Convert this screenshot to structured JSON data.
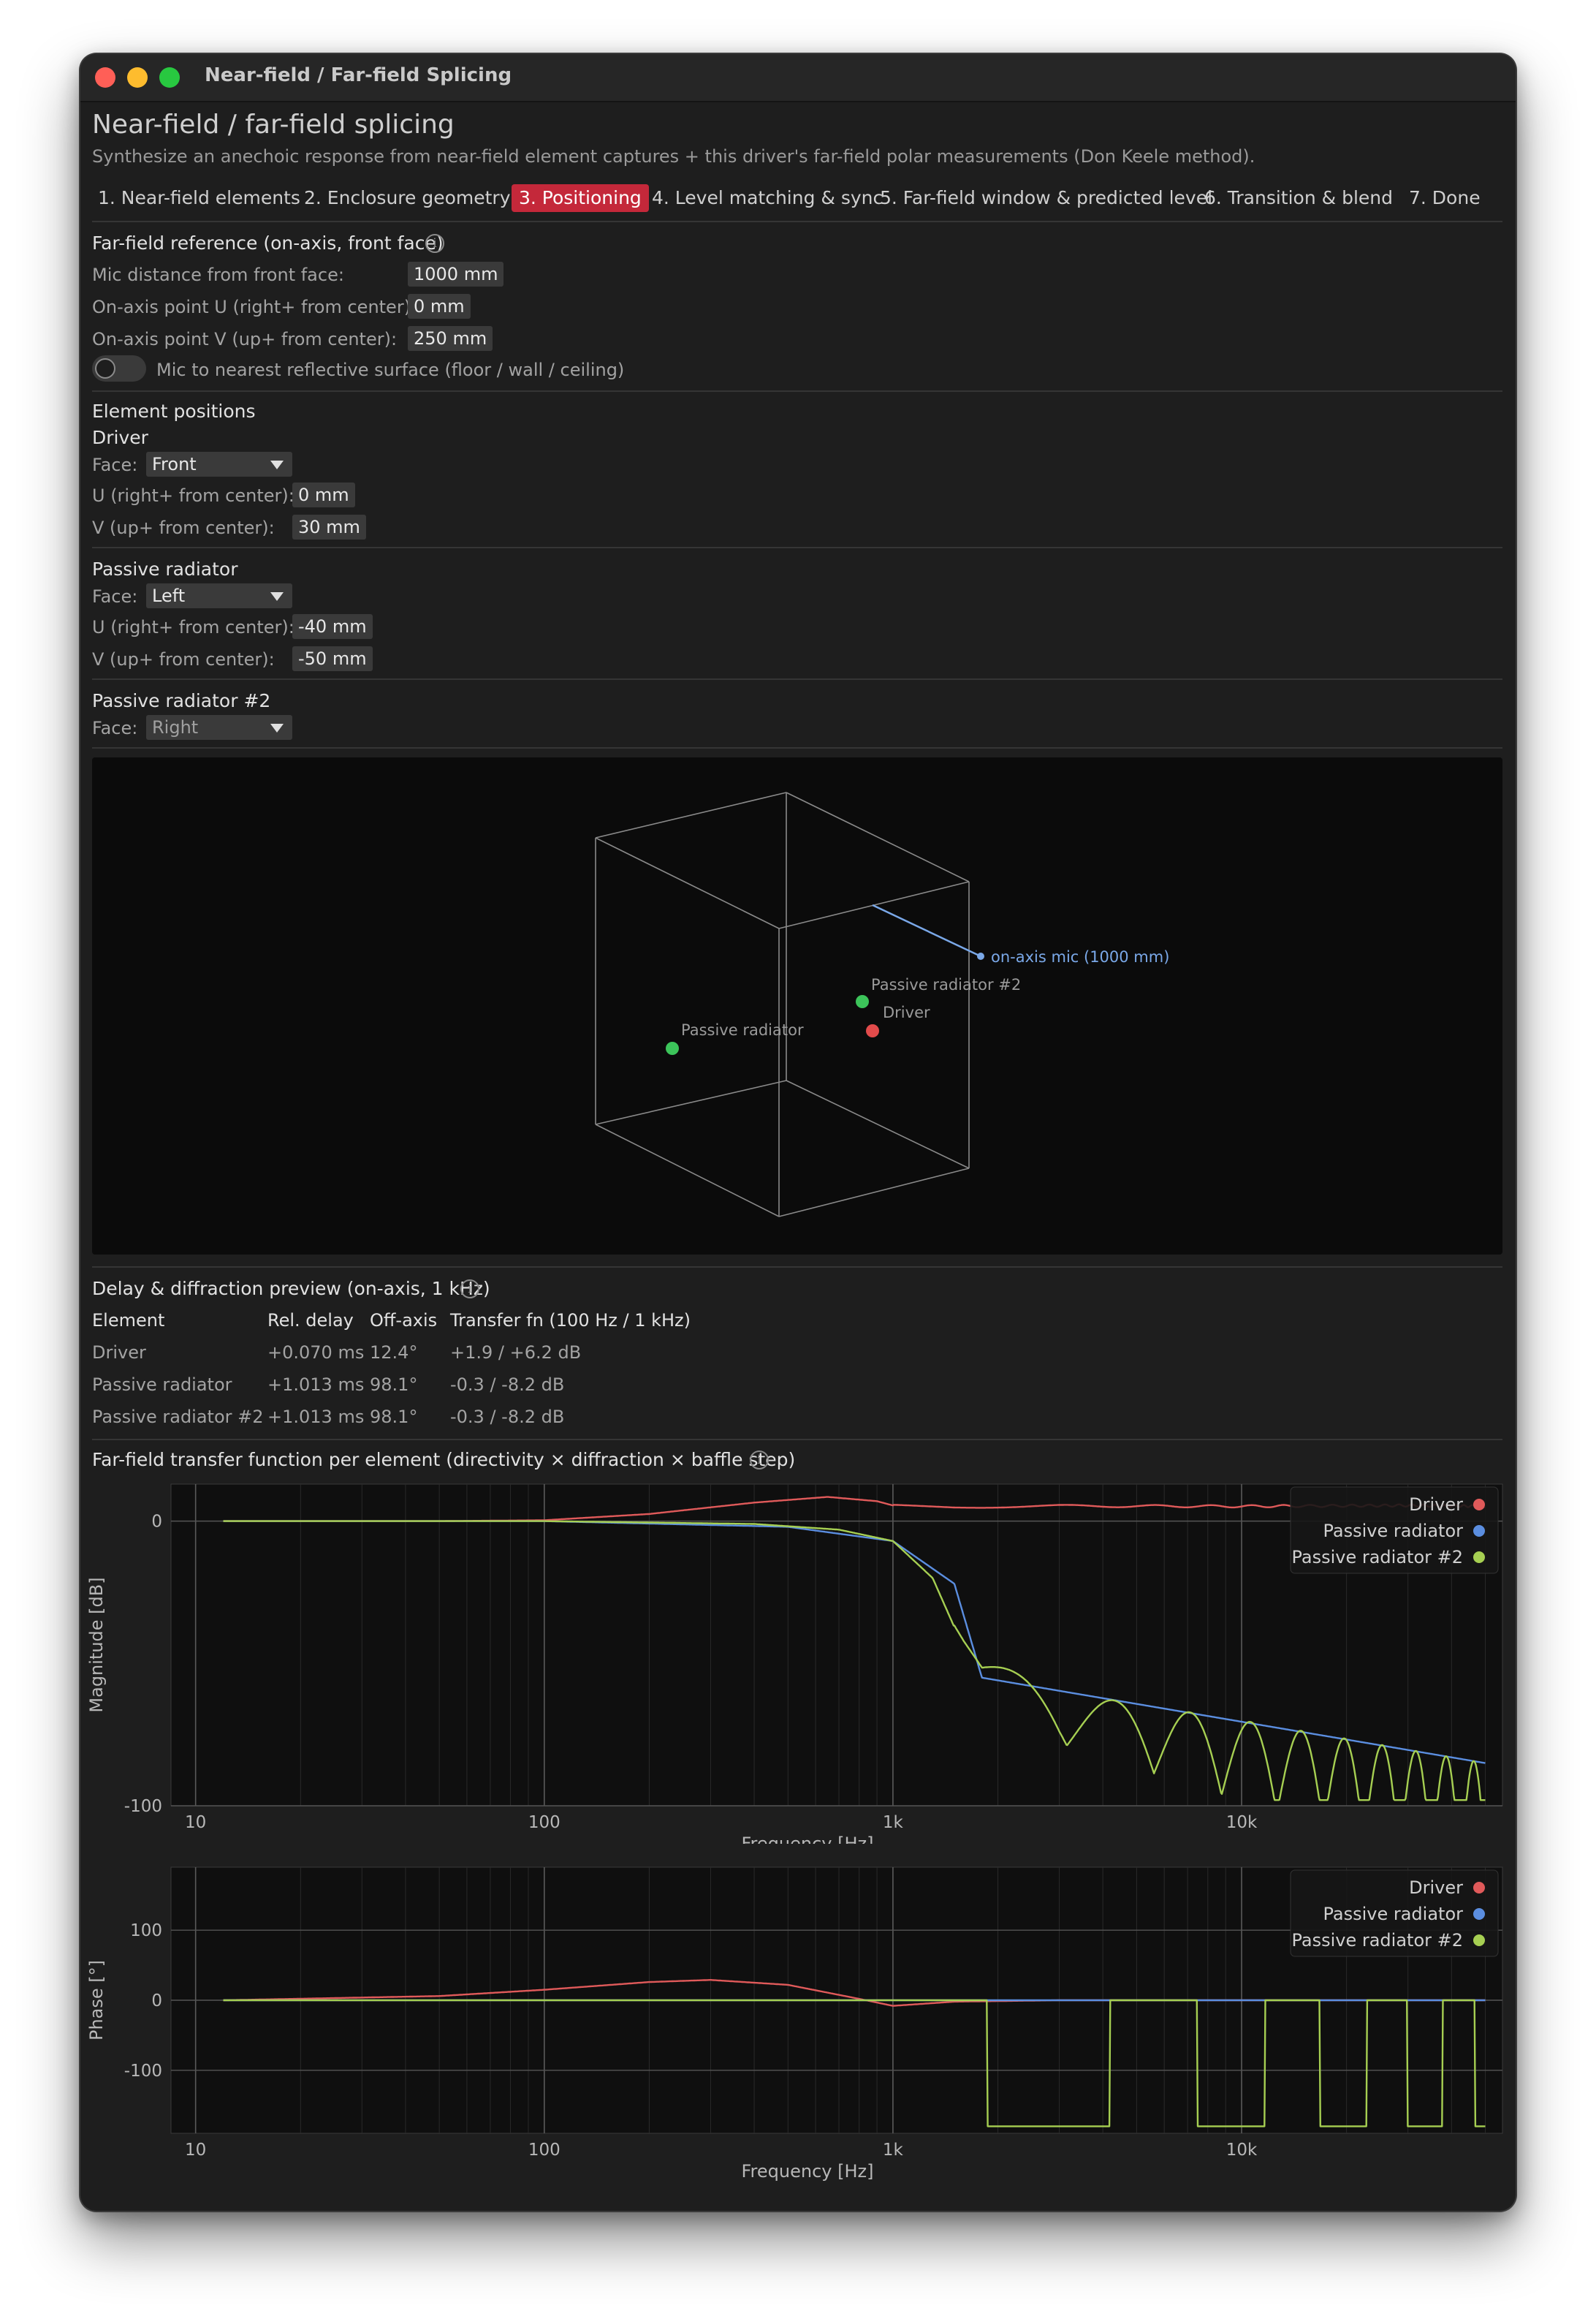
{
  "window": {
    "title": "Near-field / Far-field Splicing"
  },
  "header": {
    "title": "Near-field / far-field splicing",
    "subtitle": "Synthesize an anechoic response from near-field element captures + this driver's far-field polar measurements (Don Keele method)."
  },
  "tabs": [
    {
      "label": "1. Near-field elements",
      "active": false
    },
    {
      "label": "2. Enclosure geometry",
      "active": false
    },
    {
      "label": "3. Positioning",
      "active": true
    },
    {
      "label": "4. Level matching & sync",
      "active": false
    },
    {
      "label": "5. Far-field window & predicted level",
      "active": false
    },
    {
      "label": "6. Transition & blend",
      "active": false
    },
    {
      "label": "7. Done",
      "active": false
    }
  ],
  "far_field_ref": {
    "heading": "Far-field reference (on-axis, front face)",
    "mic_distance_label": "Mic distance from front face:",
    "mic_distance_value": "1000 mm",
    "point_u_label": "On-axis point U (right+ from center):",
    "point_u_value": "0 mm",
    "point_v_label": "On-axis point V (up+ from center):",
    "point_v_value": "250 mm",
    "reflect_toggle_label": "Mic to nearest reflective surface (floor / wall / ceiling)",
    "reflect_toggle_on": false
  },
  "element_positions": {
    "heading": "Element positions",
    "face_label": "Face:",
    "u_label": "U (right+ from center):",
    "v_label": "V (up+ from center):",
    "elements": [
      {
        "name": "Driver",
        "face": "Front",
        "u": "0 mm",
        "v": "30 mm"
      },
      {
        "name": "Passive radiator",
        "face": "Left",
        "u": "-40 mm",
        "v": "-50 mm"
      },
      {
        "name": "Passive radiator #2",
        "face": "Right"
      }
    ]
  },
  "scene": {
    "mic_label": "on-axis mic (1000 mm)",
    "labels": {
      "pr2": "Passive radiator #2",
      "driver": "Driver",
      "pr": "Passive radiator"
    },
    "colors": {
      "driver": "#e24b4b",
      "passive": "#3cc45a",
      "mic": "#7aa8e8",
      "edges": "#8a8a8a"
    }
  },
  "delay_preview": {
    "heading": "Delay & diffraction preview (on-axis, 1 kHz)",
    "columns": [
      "Element",
      "Rel. delay",
      "Off-axis",
      "Transfer fn (100 Hz / 1 kHz)"
    ],
    "rows": [
      [
        "Driver",
        "+0.070 ms",
        "12.4°",
        "+1.9 / +6.2 dB"
      ],
      [
        "Passive radiator",
        "+1.013 ms",
        "98.1°",
        "-0.3 / -8.2 dB"
      ],
      [
        "Passive radiator #2",
        "+1.013 ms",
        "98.1°",
        "-0.3 / -8.2 dB"
      ]
    ]
  },
  "transfer_section": {
    "heading": "Far-field transfer function per element (directivity × diffraction × baffle step)"
  },
  "chart_data": [
    {
      "type": "line",
      "xlabel": "Frequency [Hz]",
      "ylabel": "Magnitude [dB]",
      "xscale": "log",
      "xlim": [
        8.5,
        56000
      ],
      "ylim": [
        -100,
        13
      ],
      "xticks": [
        10,
        100,
        1000,
        10000
      ],
      "xtick_labels": [
        "10",
        "100",
        "1k",
        "10k"
      ],
      "yticks": [
        0,
        -100
      ],
      "ytick_labels": [
        "0",
        "-100"
      ],
      "grid": true,
      "legend": "top-right",
      "series": [
        {
          "name": "Driver",
          "color": "#e05a5a",
          "x": [
            12,
            50,
            100,
            200,
            400,
            650,
            900,
            1000,
            1500,
            3000,
            10000,
            30000,
            50000
          ],
          "y": [
            0,
            0,
            0.3,
            2.5,
            6.5,
            8.5,
            7.0,
            5.5,
            5.0,
            5.3,
            5.2,
            5.5,
            5.2
          ]
        },
        {
          "name": "Passive radiator",
          "color": "#5b8ee0",
          "x": [
            12,
            100,
            500,
            1000,
            1500,
            1800,
            50000
          ],
          "y": [
            0,
            0,
            -2,
            -7,
            -22,
            -55,
            -85
          ]
        },
        {
          "name": "Passive radiator #2",
          "color": "#a6cf52",
          "x": [
            12,
            100,
            400,
            700,
            1000,
            1300,
            1600,
            1800,
            3000,
            10000,
            50000
          ],
          "y": [
            0,
            0,
            -1,
            -3,
            -7,
            -20,
            -45,
            -58,
            -70,
            -80,
            -95
          ]
        }
      ]
    },
    {
      "type": "line",
      "xlabel": "Frequency [Hz]",
      "ylabel": "Phase [°]",
      "xscale": "log",
      "xlim": [
        8.5,
        56000
      ],
      "ylim": [
        -190,
        190
      ],
      "xticks": [
        10,
        100,
        1000,
        10000
      ],
      "xtick_labels": [
        "10",
        "100",
        "1k",
        "10k"
      ],
      "yticks": [
        100,
        0,
        -100
      ],
      "ytick_labels": [
        "100",
        "0",
        "-100"
      ],
      "grid": true,
      "legend": "top-right",
      "series": [
        {
          "name": "Driver",
          "color": "#e05a5a",
          "x": [
            12,
            50,
            100,
            200,
            300,
            500,
            800,
            1000,
            1500,
            3000,
            50000
          ],
          "y": [
            0,
            6,
            15,
            26,
            29,
            22,
            2,
            -8,
            -2,
            0,
            0
          ]
        },
        {
          "name": "Passive radiator",
          "color": "#5b8ee0",
          "x": [
            12,
            1000,
            50000
          ],
          "y": [
            0,
            0,
            0
          ]
        },
        {
          "name": "Passive radiator #2",
          "color": "#a6cf52",
          "x": [
            12,
            1000,
            1700,
            50000
          ],
          "y": [
            0,
            0,
            0,
            0
          ]
        }
      ]
    }
  ]
}
